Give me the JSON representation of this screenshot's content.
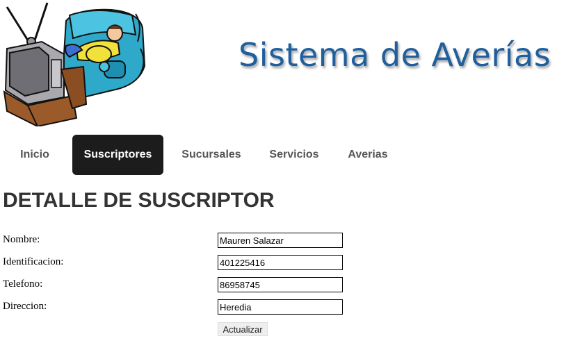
{
  "header": {
    "title": "Sistema de Averías"
  },
  "nav": {
    "items": [
      {
        "label": "Inicio"
      },
      {
        "label": "Suscriptores"
      },
      {
        "label": "Sucursales"
      },
      {
        "label": "Servicios"
      },
      {
        "label": "Averias"
      }
    ],
    "active_index": 1
  },
  "page": {
    "title": "DETALLE DE SUSCRIPTOR"
  },
  "form": {
    "fields": [
      {
        "label": "Nombre:",
        "value": "Mauren Salazar"
      },
      {
        "label": "Identificacion:",
        "value": "401225416"
      },
      {
        "label": "Telefono:",
        "value": "86958745"
      },
      {
        "label": "Direccion:",
        "value": "Heredia"
      }
    ],
    "submit_label": "Actualizar"
  },
  "colors": {
    "title_blue": "#1f5f9e",
    "nav_active_bg": "#1c1c1c",
    "nav_text": "#555555"
  }
}
